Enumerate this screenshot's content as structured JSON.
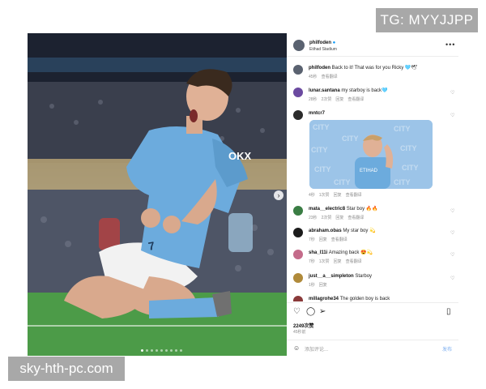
{
  "watermarks": {
    "top": "TG: MYYJJPP",
    "bottom": "sky-hth-pc.com"
  },
  "post": {
    "username": "philfoden",
    "location": "Etihad Stadium",
    "caption": "Back to it! That was for you Ricky 🩵🕊",
    "caption_time": "45秒",
    "caption_action": "查看翻译",
    "likes": "2249次赞",
    "posted": "45秒前",
    "comment_placeholder": "添加评论...",
    "post_button": "发布",
    "kit_sponsor": "ETIHAD",
    "image_alt_text": "OKX"
  },
  "comments": [
    {
      "user": "lunar.santana",
      "text": "my starboy is back🩵",
      "meta": [
        "28秒",
        "2次赞",
        "回复",
        "查看翻译"
      ],
      "avatar_color": "#6b4aa0"
    },
    {
      "user": "mntcr7",
      "text": "",
      "meta": [
        "4秒",
        "1次赞",
        "回复",
        "查看翻译"
      ],
      "avatar_color": "#2b2b2b",
      "gif_label": "CITY"
    },
    {
      "user": "mata__electric8",
      "text": "Star boy 🔥🔥",
      "meta": [
        "23秒",
        "2次赞",
        "回复",
        "查看翻译"
      ],
      "avatar_color": "#3a7d44"
    },
    {
      "user": "abraham.obas",
      "text": "My star boy 💫",
      "meta": [
        "7秒",
        "回复",
        "查看翻译"
      ],
      "avatar_color": "#1c1c1c"
    },
    {
      "user": "sha_l11i",
      "text": "Amazing back 😍💫",
      "meta": [
        "7秒",
        "1次赞",
        "回复",
        "查看翻译"
      ],
      "avatar_color": "#c46b8a"
    },
    {
      "user": "just__a__simpleton",
      "text": "Starboy",
      "meta": [
        "1秒",
        "回复"
      ],
      "avatar_color": "#b08a3a"
    },
    {
      "user": "millagrohe34",
      "text": "The golden boy is back",
      "meta": [],
      "avatar_color": "#8a3a3a"
    }
  ],
  "icons": [
    "verified-badge-icon",
    "more-options-icon",
    "heart-icon",
    "comment-icon",
    "share-icon",
    "bookmark-icon",
    "emoji-icon",
    "carousel-next-icon"
  ],
  "colors": {
    "accent_blue": "#0095f6",
    "city_blue": "#6cabdd"
  }
}
